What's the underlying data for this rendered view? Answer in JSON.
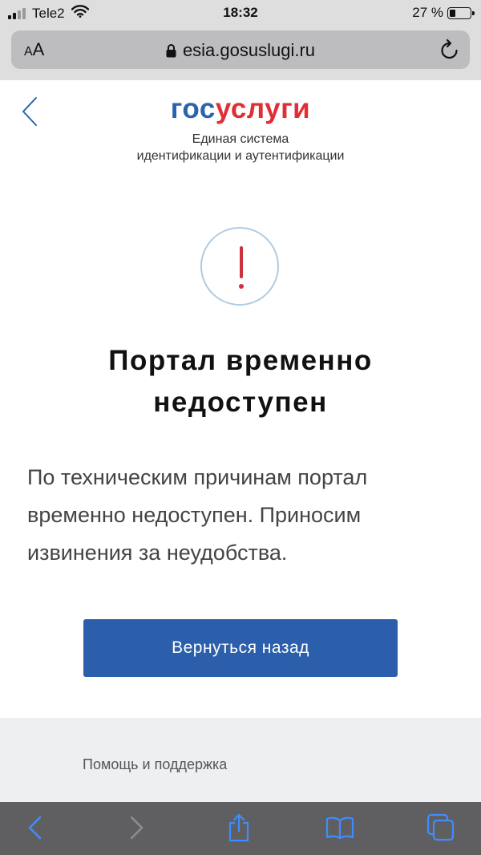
{
  "status_bar": {
    "carrier": "Tele2",
    "time": "18:32",
    "battery": "27 %",
    "battery_level": 0.27
  },
  "browser": {
    "text_size_label_small": "A",
    "text_size_label_large": "A",
    "url": "esia.gosuslugi.ru"
  },
  "header": {
    "logo_part1": "гос",
    "logo_part2": "услуги",
    "subtitle_line1": "Единая система",
    "subtitle_line2": "идентификации и аутентификации"
  },
  "error": {
    "title_line1": "Портал временно",
    "title_line2": "недоступен",
    "message": "По техническим причинам портал временно недоступен. Приносим извинения за неудобства."
  },
  "actions": {
    "return_label": "Вернуться назад"
  },
  "footer": {
    "help_label": "Помощь и поддержка"
  },
  "colors": {
    "brand_blue": "#2b64ad",
    "brand_red": "#e12e36",
    "button_blue": "#2b5fab",
    "alert_red": "#cc3142"
  },
  "icons": {
    "back": "chevron-left-icon",
    "alert": "exclamation-icon",
    "lock": "lock-icon",
    "reload": "reload-icon",
    "toolbar": [
      "back-arrow-icon",
      "forward-arrow-icon",
      "share-icon",
      "bookmarks-icon",
      "tabs-icon"
    ]
  }
}
